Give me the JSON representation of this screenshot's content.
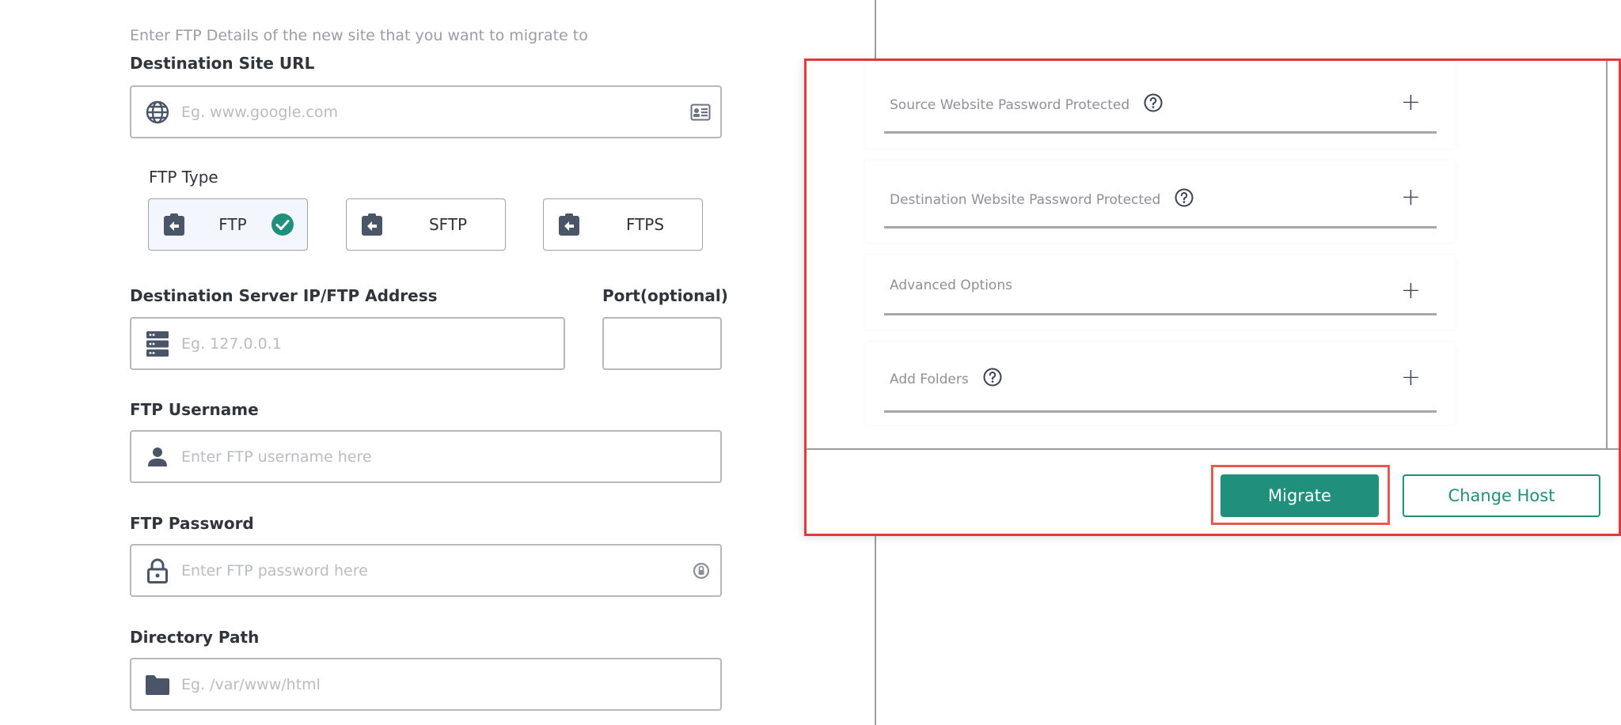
{
  "form": {
    "intro": "Enter FTP Details of the new site that you want to migrate to",
    "destination_url": {
      "label": "Destination Site URL",
      "placeholder": "Eg. www.google.com"
    },
    "ftp_type": {
      "label": "FTP Type",
      "options": [
        "FTP",
        "SFTP",
        "FTPS"
      ],
      "selected": "FTP"
    },
    "server": {
      "label": "Destination Server IP/FTP Address",
      "placeholder": "Eg. 127.0.0.1"
    },
    "port": {
      "label": "Port(optional)",
      "value": ""
    },
    "username": {
      "label": "FTP Username",
      "placeholder": "Enter FTP username here"
    },
    "password": {
      "label": "FTP Password",
      "placeholder": "Enter FTP password here"
    },
    "directory": {
      "label": "Directory Path",
      "placeholder": "Eg. /var/www/html"
    }
  },
  "panel": {
    "sections": [
      {
        "title": "Source Website Password Protected",
        "help": true
      },
      {
        "title": "Destination Website Password Protected",
        "help": true
      },
      {
        "title": "Advanced Options",
        "help": false
      },
      {
        "title": "Add Folders",
        "help": true
      }
    ],
    "migrate_label": "Migrate",
    "change_host_label": "Change Host"
  },
  "colors": {
    "accent": "#20907c",
    "highlight": "#e03b3b",
    "icon": "#4a5568"
  }
}
